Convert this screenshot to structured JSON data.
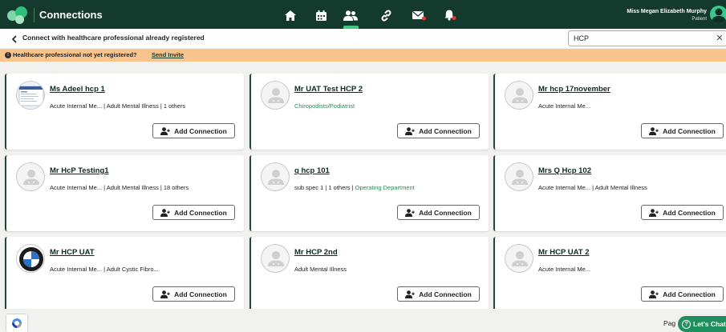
{
  "header": {
    "title": "Connections",
    "nav_icons": [
      "home-icon",
      "calendar-icon",
      "people-icon",
      "link-icon",
      "mail-icon",
      "bell-icon"
    ],
    "active_nav": "people-icon",
    "user": {
      "name": "Miss Megan Elizabeth Murphy",
      "role": "Patient"
    }
  },
  "subheader": {
    "back_icon": "chevron-left-icon",
    "title": "Connect with healthcare professional already registered",
    "search": {
      "value": "HCP",
      "clear_icon": "close-icon"
    }
  },
  "notice": {
    "text": "Healthcare professional not yet registered?",
    "link": "Send Invite"
  },
  "cards": [
    {
      "name": "Ms Adeel hcp 1",
      "spec": "Acute Internal Me... | Adult Mental Illness | 1 others",
      "spec_green": "",
      "avatar": "screenshot-image",
      "button": "Add Connection"
    },
    {
      "name": "Mr UAT Test HCP 2",
      "spec": "",
      "spec_green": "Chiropodists/Podiatrist",
      "avatar": "default-user-icon",
      "button": "Add Connection"
    },
    {
      "name": "Mr hcp 17november",
      "spec": "Acute Internal Me...",
      "spec_green": "",
      "avatar": "default-user-icon",
      "button": "Add Connection"
    },
    {
      "name": "Mr HcP Testing1",
      "spec": "Acute Internal Me... | Adult Mental Illness | 18 others",
      "spec_green": "",
      "avatar": "default-user-icon",
      "button": "Add Connection"
    },
    {
      "name": "q hcp 101",
      "spec": "sub spec 1 | 1 others | ",
      "spec_green": "Operating Department",
      "avatar": "default-user-icon",
      "button": "Add Connection"
    },
    {
      "name": "Mrs Q Hcp 102",
      "spec": "Acute Internal Me... | Adult Mental Illness",
      "spec_green": "",
      "avatar": "default-user-icon",
      "button": "Add Connection"
    },
    {
      "name": "Mr HCP UAT",
      "spec": "Acute Internal Me... | Adult Cystic Fibro...",
      "spec_green": "",
      "avatar": "bmw-logo",
      "button": "Add Connection"
    },
    {
      "name": "Mr HCP 2nd",
      "spec": "Adult Mental Illness",
      "spec_green": "",
      "avatar": "default-user-icon",
      "button": "Add Connection"
    },
    {
      "name": "Mr HCP UAT 2",
      "spec": "Acute Internal Me...",
      "spec_green": "",
      "avatar": "default-user-icon",
      "button": "Add Connection"
    }
  ],
  "footer": {
    "page_label": "Pag",
    "chat_label": "Let's Chat"
  },
  "colors": {
    "header_bg": "#143a2d",
    "accent": "#3ec882",
    "notice_bg": "#f7c48d",
    "spec_green": "#2e8b57",
    "chat_bg": "#1e8f5e"
  }
}
